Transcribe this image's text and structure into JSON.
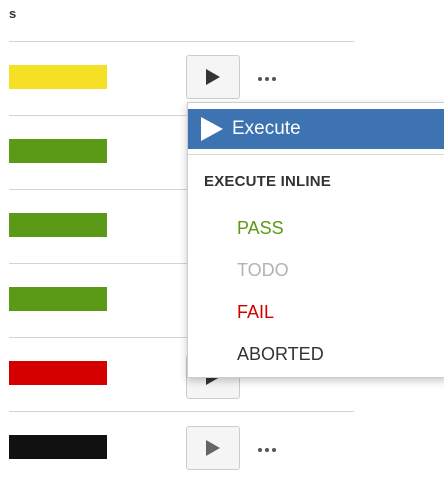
{
  "table": {
    "column_header": "s",
    "rows": [
      {
        "status_color": "#f5e026",
        "show_play": true
      },
      {
        "status_color": "#5b9a16",
        "show_play": false
      },
      {
        "status_color": "#5b9a16",
        "show_play": false
      },
      {
        "status_color": "#5b9a16",
        "show_play": false
      },
      {
        "status_color": "#d40000",
        "show_play": true
      },
      {
        "status_color": "#111111",
        "show_play": true
      }
    ],
    "play_icon": "play-icon",
    "more_icon": "more-horizontal-icon"
  },
  "menu": {
    "execute_label": "Execute",
    "execute_icon": "play-icon",
    "section_title": "EXECUTE INLINE",
    "items": [
      {
        "label": "PASS",
        "color": "#5b9a16"
      },
      {
        "label": "TODO",
        "color": "#b3b3b3"
      },
      {
        "label": "FAIL",
        "color": "#d40000"
      },
      {
        "label": "ABORTED",
        "color": "#333333"
      }
    ],
    "accent_color": "#3c73b0"
  }
}
